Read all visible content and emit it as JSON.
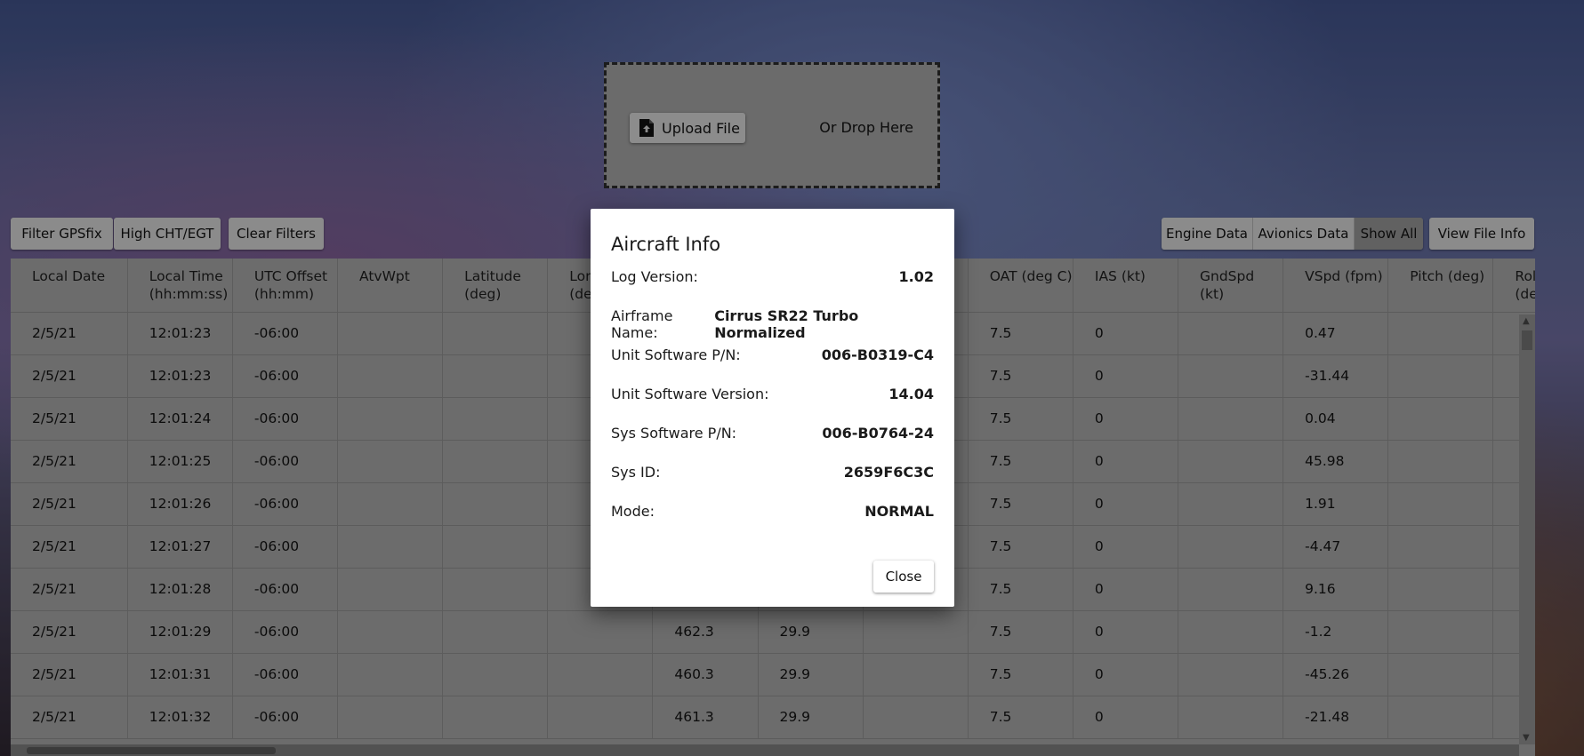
{
  "upload": {
    "button_label": "Upload File",
    "drop_text": "Or Drop Here"
  },
  "filters": {
    "gps": "Filter GPSfix",
    "high": "High CHT/EGT",
    "clear": "Clear Filters"
  },
  "views": {
    "engine": "Engine Data",
    "avionics": "Avionics Data",
    "all": "Show All",
    "file_info": "View File Info"
  },
  "table": {
    "headers": [
      "Local Date",
      "Local Time (hh:mm:ss)",
      "UTC Offset (hh:mm)",
      "AtvWpt",
      "Latitude (deg)",
      "Longitude (deg)",
      "",
      "",
      "",
      "OAT (deg C)",
      "IAS (kt)",
      "GndSpd (kt)",
      "VSpd (fpm)",
      "Pitch (deg)",
      "Roll (deg)"
    ],
    "rows": [
      [
        "2/5/21",
        "12:01:23",
        "-06:00",
        "",
        "",
        "",
        "",
        "",
        "",
        "7.5",
        "0",
        "",
        "0.47",
        "",
        ""
      ],
      [
        "2/5/21",
        "12:01:23",
        "-06:00",
        "",
        "",
        "",
        "",
        "",
        "",
        "7.5",
        "0",
        "",
        "-31.44",
        "",
        ""
      ],
      [
        "2/5/21",
        "12:01:24",
        "-06:00",
        "",
        "",
        "",
        "",
        "",
        "",
        "7.5",
        "0",
        "",
        "0.04",
        "",
        ""
      ],
      [
        "2/5/21",
        "12:01:25",
        "-06:00",
        "",
        "",
        "",
        "",
        "",
        "",
        "7.5",
        "0",
        "",
        "45.98",
        "",
        ""
      ],
      [
        "2/5/21",
        "12:01:26",
        "-06:00",
        "",
        "",
        "",
        "",
        "",
        "",
        "7.5",
        "0",
        "",
        "1.91",
        "",
        ""
      ],
      [
        "2/5/21",
        "12:01:27",
        "-06:00",
        "",
        "",
        "",
        "",
        "",
        "",
        "7.5",
        "0",
        "",
        "-4.47",
        "",
        ""
      ],
      [
        "2/5/21",
        "12:01:28",
        "-06:00",
        "",
        "",
        "",
        "",
        "",
        "",
        "7.5",
        "0",
        "",
        "9.16",
        "",
        ""
      ],
      [
        "2/5/21",
        "12:01:29",
        "-06:00",
        "",
        "",
        "",
        "462.3",
        "29.9",
        "",
        "7.5",
        "0",
        "",
        "-1.2",
        "",
        ""
      ],
      [
        "2/5/21",
        "12:01:31",
        "-06:00",
        "",
        "",
        "",
        "460.3",
        "29.9",
        "",
        "7.5",
        "0",
        "",
        "-45.26",
        "",
        ""
      ],
      [
        "2/5/21",
        "12:01:32",
        "-06:00",
        "",
        "",
        "",
        "461.3",
        "29.9",
        "",
        "7.5",
        "0",
        "",
        "-21.48",
        "",
        ""
      ]
    ]
  },
  "dialog": {
    "title": "Aircraft Info",
    "fields": [
      {
        "label": "Log Version:",
        "value": "1.02"
      },
      {
        "label": "Airframe Name:",
        "value": "Cirrus SR22 Turbo Normalized"
      },
      {
        "label": "Unit Software P/N:",
        "value": "006-B0319-C4"
      },
      {
        "label": "Unit Software Version:",
        "value": "14.04"
      },
      {
        "label": "Sys Software P/N:",
        "value": "006-B0764-24"
      },
      {
        "label": "Sys ID:",
        "value": "2659F6C3C"
      },
      {
        "label": "Mode:",
        "value": "NORMAL"
      }
    ],
    "close_label": "Close"
  }
}
